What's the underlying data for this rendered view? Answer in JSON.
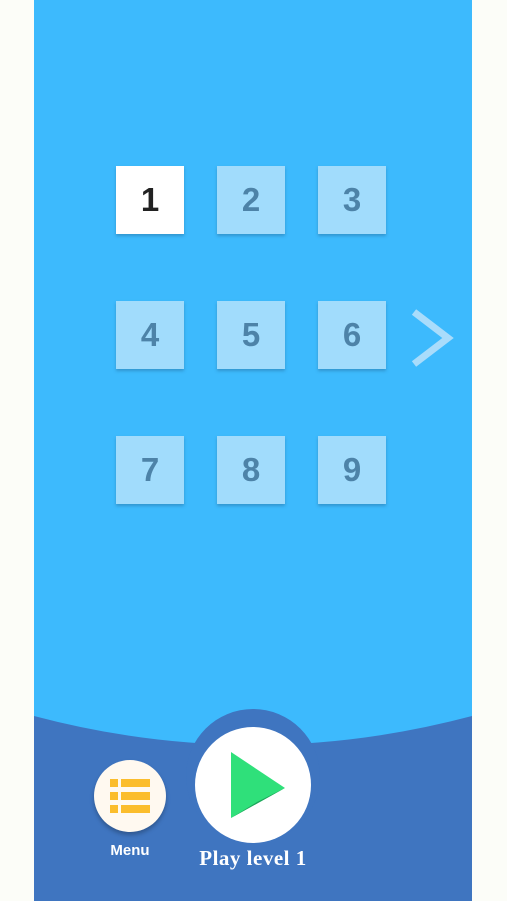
{
  "levels": {
    "tiles": [
      {
        "label": "1",
        "selected": true
      },
      {
        "label": "2",
        "selected": false
      },
      {
        "label": "3",
        "selected": false
      },
      {
        "label": "4",
        "selected": false
      },
      {
        "label": "5",
        "selected": false
      },
      {
        "label": "6",
        "selected": false
      },
      {
        "label": "7",
        "selected": false
      },
      {
        "label": "8",
        "selected": false
      },
      {
        "label": "9",
        "selected": false
      }
    ],
    "next_icon": "chevron-right-icon"
  },
  "menu": {
    "label": "Menu",
    "icon": "list-icon"
  },
  "play": {
    "label": "Play level 1",
    "icon": "play-icon"
  },
  "colors": {
    "background": "#3dbafd",
    "bottom_bar": "#3f75c0",
    "tile": "#a1dcfc",
    "tile_text": "#4d83a8",
    "tile_selected": "#ffffff",
    "menu_icon": "#fbbd2c",
    "play_icon": "#27d466"
  }
}
